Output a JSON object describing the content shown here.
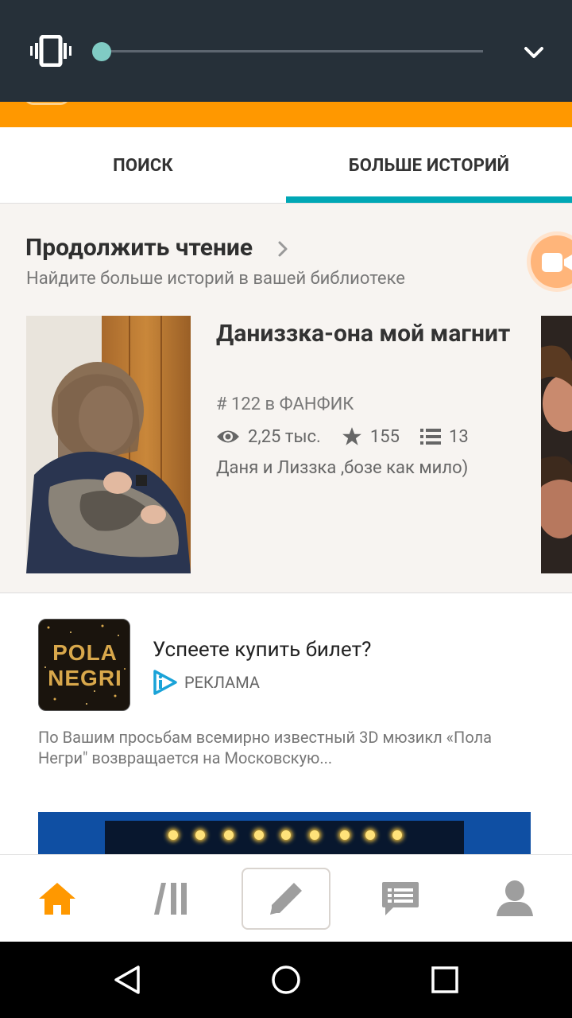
{
  "tabs": {
    "search_label": "ПОИСК",
    "more_stories_label": "БОЛЬШЕ ИСТОРИЙ"
  },
  "continue_reading": {
    "title": "Продолжить чтение",
    "subtitle": "Найдите больше историй в вашей библиотеке",
    "story": {
      "title": "Даниззка-она мой магнит",
      "rank": "# 122 в ФАНФИК",
      "reads": "2,25 тыс.",
      "votes": "155",
      "parts": "13",
      "description": "Даня и Лиззка ,бозе как мило)"
    }
  },
  "ad": {
    "logo_line1": "POLA",
    "logo_line2": "NEGRI",
    "title": "Успеете купить билет?",
    "badge_label": "РЕКЛАМА",
    "text": "По Вашим просьбам  всемирно известный 3D мюзикл «Пола Негри\" возвращается на Московскую..."
  },
  "colors": {
    "accent_orange": "#ff9800",
    "tab_indicator": "#00a7b5",
    "volume_panel": "#263039",
    "slider_thumb": "#80cbc4"
  },
  "volume": {
    "level": 0
  },
  "icons": [
    "vibrate-icon",
    "chevron-down-icon",
    "video-icon",
    "eye-icon",
    "star-icon",
    "list-icon",
    "ad-choices-icon",
    "home-icon",
    "library-icon",
    "pencil-icon",
    "message-icon",
    "profile-icon",
    "back-icon",
    "home-circle-icon",
    "recents-icon"
  ]
}
